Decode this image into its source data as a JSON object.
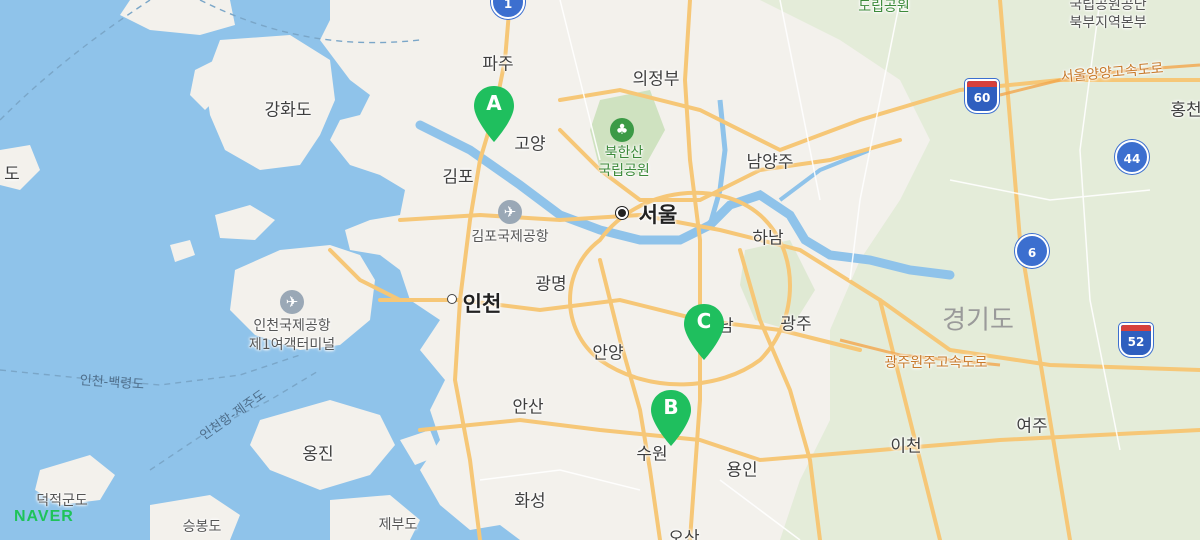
{
  "map": {
    "provider_logo": "NAVER",
    "colors": {
      "sea": "#8fc3ea",
      "land": "#f3f1ec",
      "mountain": "#dfe9d3",
      "road": "#f6c777",
      "river": "#8fc3ea",
      "marker": "#1fbf5e"
    },
    "markers": [
      {
        "letter": "A"
      },
      {
        "letter": "B"
      },
      {
        "letter": "C"
      }
    ],
    "cities": {
      "seoul": "서울",
      "paju": "파주",
      "uijeongbu": "의정부",
      "goyang": "고양",
      "gimpo": "김포",
      "namyangju": "남양주",
      "hanam": "하남",
      "incheon": "인천",
      "gwangmyeong": "광명",
      "anyang": "안양",
      "gwangju": "광주",
      "ansan": "안산",
      "suwon": "수원",
      "yongin": "용인",
      "icheon": "이천",
      "yeoju": "여주",
      "hwaseong": "화성",
      "ganghwa": "강화도",
      "ongjin": "옹진",
      "hong": "홍천",
      "osan": "오산",
      "seongnam_partial": "남",
      "do_partial": "도"
    },
    "province": "경기도",
    "parks": {
      "bukhansan": "북한산\n국립공원",
      "top_park": "도립공원",
      "ne_park": "국립공원공단\n북부지역본부"
    },
    "airports": {
      "gimpo": "김포국제공항",
      "incheon": "인천국제공항\n제1여객터미널"
    },
    "highways": {
      "seoul_yangyang": "서울양양고속도로",
      "gwangju_wonju": "광주원주고속도로"
    },
    "sea_routes": {
      "incheon_baengnyeong": "인천-백령도",
      "incheon_jeju": "인천항-제주도"
    },
    "islands": {
      "deokjeok": "덕적군도",
      "seungbong": "승봉도",
      "jebu": "제부도"
    },
    "route_shields": [
      {
        "number": "1",
        "type": "national"
      },
      {
        "number": "60",
        "type": "expressway"
      },
      {
        "number": "44",
        "type": "national"
      },
      {
        "number": "6",
        "type": "national"
      },
      {
        "number": "52",
        "type": "expressway"
      }
    ]
  }
}
